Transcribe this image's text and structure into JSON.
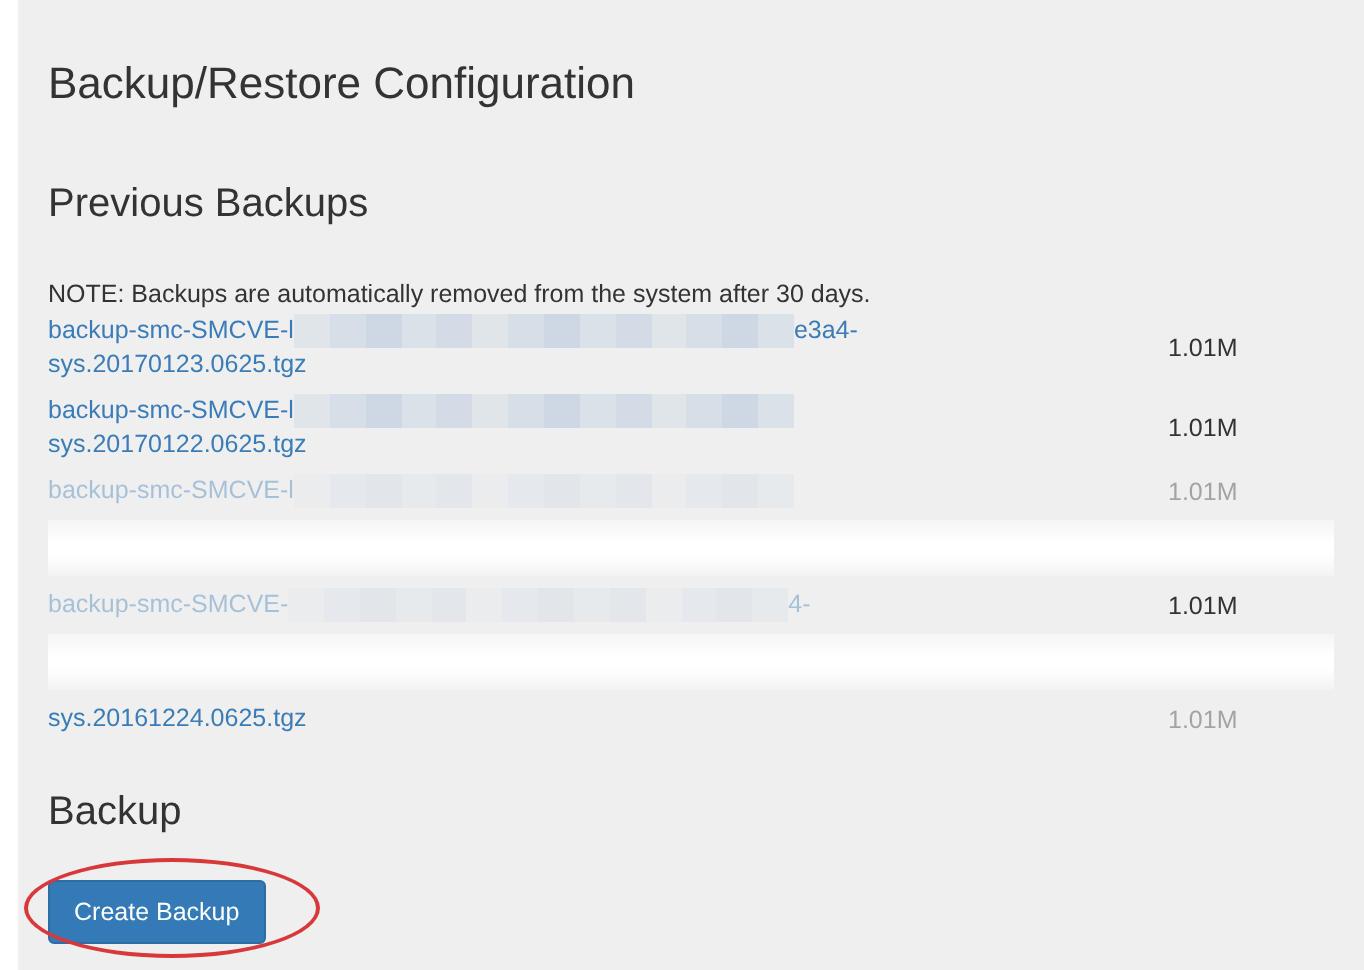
{
  "title": "Backup/Restore Configuration",
  "previous": {
    "heading": "Previous Backups",
    "note": "NOTE: Backups are automatically removed from the system after 30 days.",
    "rows": [
      {
        "prefix": "backup-smc-SMCVE-l",
        "suffix": "e3a4-",
        "line_2": "sys.20170123.0625.tgz",
        "size": "1.01M",
        "faded": false,
        "size_faded": false,
        "torn_below": false
      },
      {
        "prefix": "backup-smc-SMCVE-l",
        "line_2": "sys.20170122.0625.tgz",
        "size": "1.01M",
        "faded": false,
        "size_faded": false,
        "torn_below": false
      },
      {
        "prefix": "backup-smc-SMCVE-l",
        "size": "1.01M",
        "faded": true,
        "size_faded": true,
        "torn_below": true
      },
      {
        "prefix": "backup-smc-SMCVE-",
        "suffix": "4-",
        "size": "1.01M",
        "faded": true,
        "size_faded": false,
        "torn_below": true
      },
      {
        "line_2": "sys.20161224.0625.tgz",
        "size": "1.01M",
        "faded": false,
        "size_faded": true,
        "torn_below": false
      }
    ]
  },
  "backup": {
    "heading": "Backup",
    "button": "Create Backup",
    "circled": true
  }
}
